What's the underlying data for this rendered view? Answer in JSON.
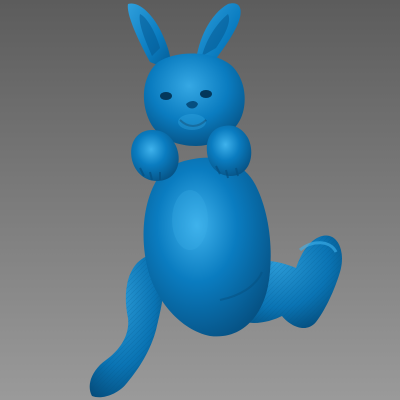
{
  "scene": {
    "subject": "bunny-3d-model",
    "colors": {
      "background_top": "#5c5c5c",
      "background_bottom": "#9a9a9a",
      "model_base": "#0a7cc0",
      "model_highlight": "#3fb2ec",
      "model_shadow": "#064f80",
      "model_dark": "#03385c"
    }
  }
}
